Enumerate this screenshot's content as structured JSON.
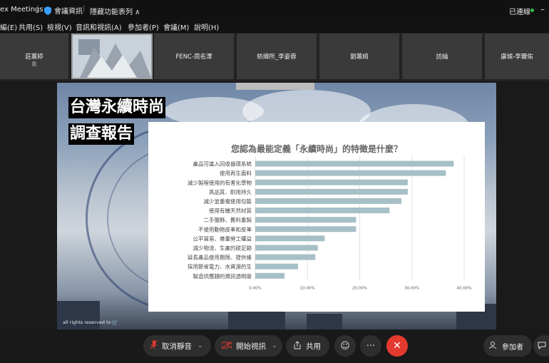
{
  "titlebar": {
    "app_name": "ex Meetings",
    "meeting_info": "會議資訊",
    "hidden_list": "隱藏功能表列 ∧",
    "connection": "已連線"
  },
  "menu": {
    "items": [
      "編(E)",
      "共用(S)",
      "檢視(V)",
      "音訊和視訊(A)",
      "參加者(P)",
      "會議(M)",
      "說明(H)"
    ]
  },
  "participants": [
    {
      "name": "莊蕙婷",
      "sub": "我"
    },
    {
      "name": "",
      "sub": ""
    },
    {
      "name": "FENC-周名澤",
      "sub": ""
    },
    {
      "name": "紡織所_李姿蓉",
      "sub": ""
    },
    {
      "name": "劉蕙綺",
      "sub": ""
    },
    {
      "name": "訪綸",
      "sub": ""
    },
    {
      "name": "康城-李爾佑",
      "sub": ""
    }
  ],
  "slide": {
    "title_line1": "台灣永續時尚",
    "title_line2": "調查報告",
    "rights": "all rights reserved to"
  },
  "chart_data": {
    "type": "bar",
    "orientation": "horizontal",
    "title": "您認為最能定義「永續時尚」的特徵是什麼？",
    "categories": [
      "產品可進入回收循環系統",
      "使用再生面料",
      "減少製程使用的有害化學物",
      "高品質、耐用持久",
      "減少並重複使用包裝",
      "使用有機天然材質",
      "二手服飾、舊料重製",
      "不使用動物皮革和皮革",
      "公平貿易、尊重勞工權益",
      "減少物流、生產的碳足跡",
      "延長產品使用期限、提供維",
      "採用節省電力、水資源的生",
      "製造供應鏈的資訊透明度"
    ],
    "values": [
      38.0,
      36.5,
      29.2,
      29.2,
      28.0,
      25.7,
      19.3,
      19.3,
      13.3,
      12.0,
      11.5,
      8.2,
      5.6
    ],
    "xlim": [
      0,
      40
    ],
    "xticks": [
      "0.00%",
      "10.00%",
      "20.00%",
      "30.00%",
      "40.00%"
    ],
    "grid": true,
    "bar_color": "#a7bfc7"
  },
  "toolbar": {
    "mute": "取消靜音",
    "video": "開始視訊",
    "share": "共用",
    "participants": "參加者",
    "more": "···",
    "end": "✕"
  },
  "colors": {
    "end_button": "#e4392f",
    "connected_dot": "#2fbf4a",
    "mute_icon": "#e4392f"
  }
}
